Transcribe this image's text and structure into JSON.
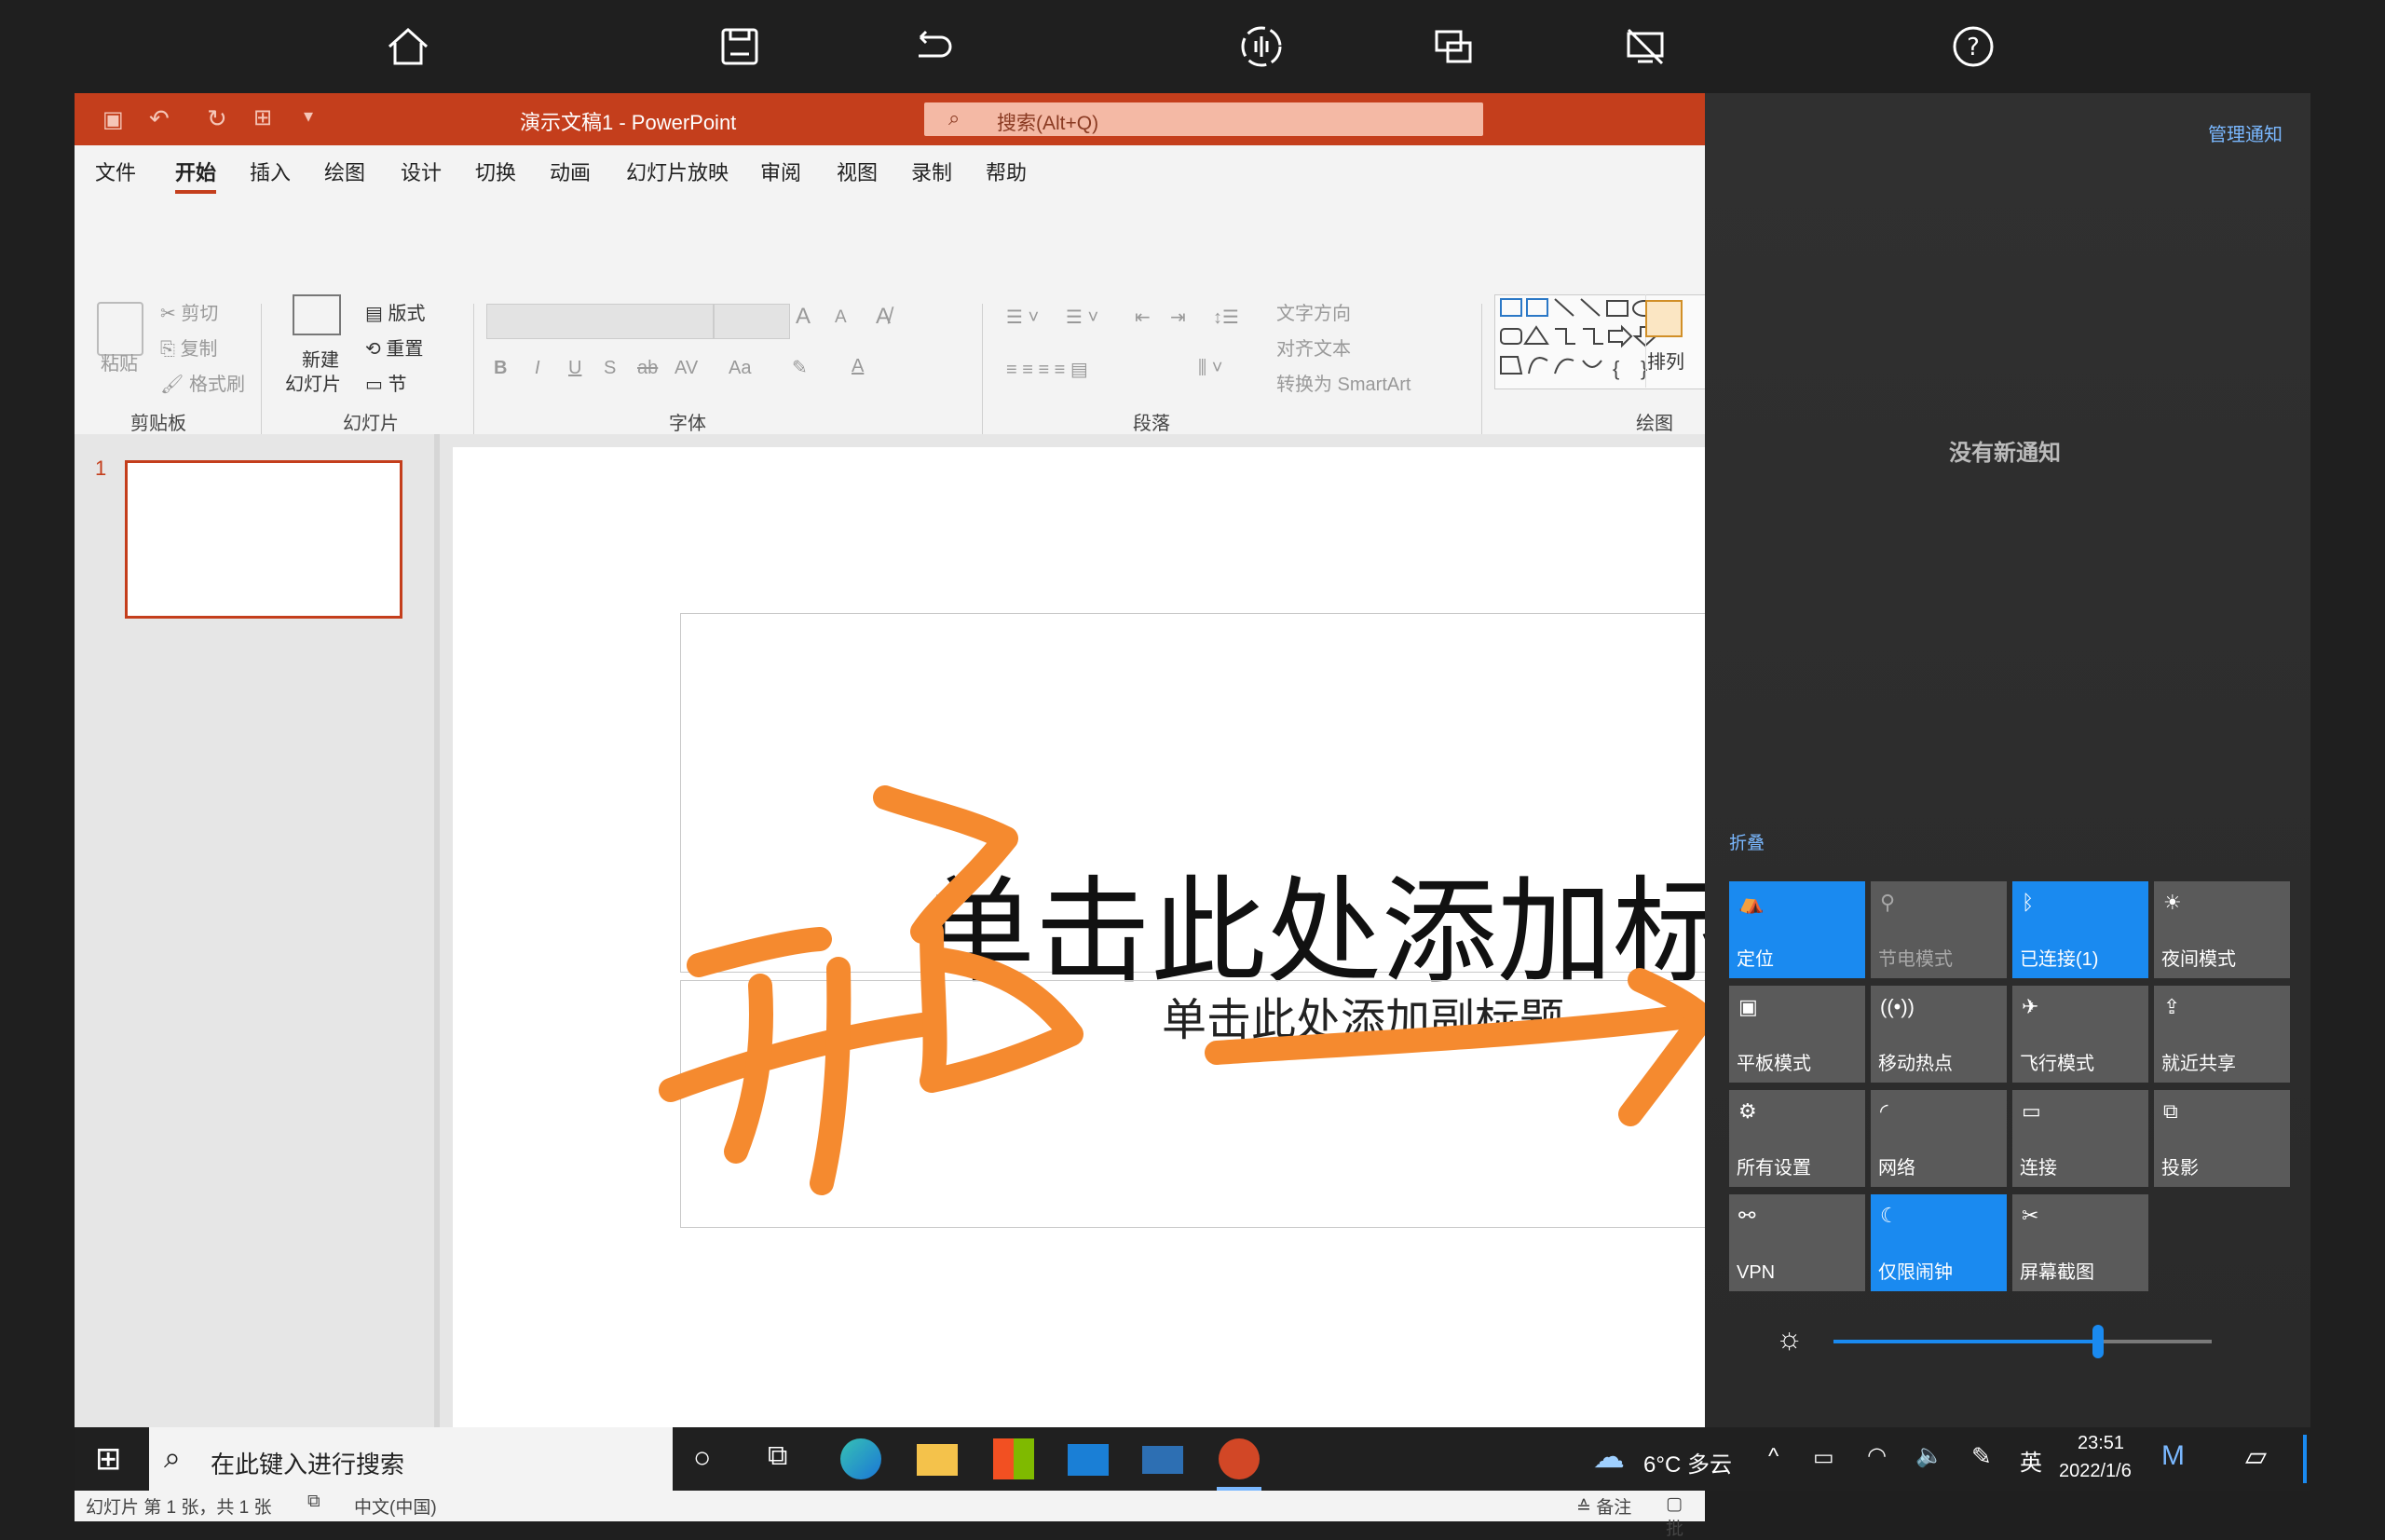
{
  "remote_toolbar": {
    "icons": [
      "home-icon",
      "save-icon",
      "undo-icon",
      "audio-icon",
      "screen-share-icon",
      "screen-off-icon",
      "help-icon"
    ]
  },
  "window": {
    "title": "演示文稿1  -  PowerPoint",
    "search_placeholder": "搜索(Alt+Q)"
  },
  "menu": [
    "文件",
    "开始",
    "插入",
    "绘图",
    "设计",
    "切换",
    "动画",
    "幻灯片放映",
    "审阅",
    "视图",
    "录制",
    "帮助"
  ],
  "ribbon": {
    "clipboard": {
      "paste": "粘贴",
      "cut": "剪切",
      "copy": "复制",
      "format_painter": "格式刷",
      "label": "剪贴板"
    },
    "slides": {
      "new_slide_1": "新建",
      "new_slide_2": "幻灯片",
      "layout": "版式",
      "reset": "重置",
      "section": "节",
      "label": "幻灯片"
    },
    "font": {
      "label": "字体",
      "bold": "B",
      "italic": "I",
      "underline": "U",
      "shadow": "S",
      "strike": "ab",
      "spacing": "AV",
      "case": "Aa",
      "grow": "A",
      "shrink": "A"
    },
    "paragraph": {
      "text_direction": "文字方向",
      "align_text": "对齐文本",
      "smartart": "转换为 SmartArt",
      "label": "段落"
    },
    "drawing": {
      "arrange": "排列",
      "label": "绘图"
    }
  },
  "thumbnail": {
    "number": "1"
  },
  "slide": {
    "title_placeholder": "单击此处添加标",
    "subtitle_placeholder": "单击此处添加副标题"
  },
  "annotation": {
    "handwriting": "开启"
  },
  "statusbar": {
    "slide_info": "幻灯片 第 1 张，共 1 张",
    "language": "中文(中国)",
    "notes": "备注",
    "comments": "批"
  },
  "notifications": {
    "manage": "管理通知",
    "empty": "没有新通知",
    "collapse": "折叠",
    "tiles": [
      {
        "label": "定位",
        "icon": "location-icon",
        "state": "on"
      },
      {
        "label": "节电模式",
        "icon": "battery-saver-icon",
        "state": "dim"
      },
      {
        "label": "已连接(1)",
        "icon": "bluetooth-icon",
        "state": "on"
      },
      {
        "label": "夜间模式",
        "icon": "night-light-icon",
        "state": "off"
      },
      {
        "label": "平板模式",
        "icon": "tablet-mode-icon",
        "state": "off"
      },
      {
        "label": "移动热点",
        "icon": "hotspot-icon",
        "state": "off"
      },
      {
        "label": "飞行模式",
        "icon": "airplane-icon",
        "state": "off"
      },
      {
        "label": "就近共享",
        "icon": "nearby-share-icon",
        "state": "off"
      },
      {
        "label": "所有设置",
        "icon": "settings-icon",
        "state": "off"
      },
      {
        "label": "网络",
        "icon": "network-icon",
        "state": "off"
      },
      {
        "label": "连接",
        "icon": "connect-icon",
        "state": "off"
      },
      {
        "label": "投影",
        "icon": "project-icon",
        "state": "off"
      },
      {
        "label": "VPN",
        "icon": "vpn-icon",
        "state": "off"
      },
      {
        "label": "仅限闹钟",
        "icon": "focus-assist-icon",
        "state": "on"
      },
      {
        "label": "屏幕截图",
        "icon": "snip-icon",
        "state": "off"
      }
    ],
    "brightness": 0.7
  },
  "taskbar": {
    "search_placeholder": "在此键入进行搜索",
    "weather": "6°C 多云",
    "ime": "英",
    "time": "23:51",
    "date": "2022/1/6"
  },
  "colors": {
    "ppt_accent": "#c43e1c",
    "tile_on": "#1a8af0",
    "ink": "#f58a2f"
  }
}
